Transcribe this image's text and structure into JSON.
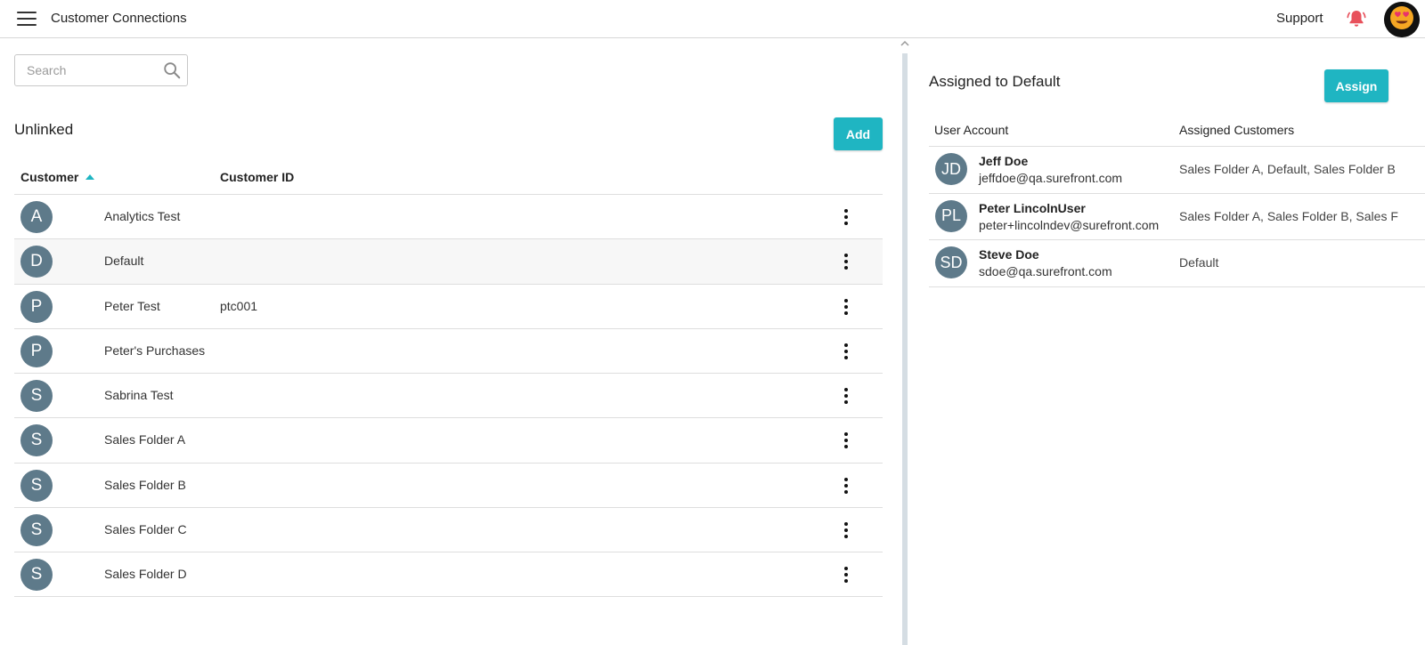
{
  "header": {
    "title": "Customer Connections",
    "support_label": "Support",
    "icons": {
      "menu": "hamburger-menu-icon",
      "bell": "bell-icon",
      "avatar": "emoji-heart-eyes-avatar"
    }
  },
  "search": {
    "placeholder": "Search",
    "value": ""
  },
  "unlinked": {
    "title": "Unlinked",
    "add_label": "Add",
    "columns": {
      "customer": "Customer",
      "customer_id": "Customer ID"
    },
    "sort": "ascending",
    "rows": [
      {
        "initial": "A",
        "name": "Analytics Test",
        "id": ""
      },
      {
        "initial": "D",
        "name": "Default",
        "id": ""
      },
      {
        "initial": "P",
        "name": "Peter Test",
        "id": "ptc001"
      },
      {
        "initial": "P",
        "name": "Peter's Purchases",
        "id": ""
      },
      {
        "initial": "S",
        "name": "Sabrina Test",
        "id": ""
      },
      {
        "initial": "S",
        "name": "Sales Folder A",
        "id": ""
      },
      {
        "initial": "S",
        "name": "Sales Folder B",
        "id": ""
      },
      {
        "initial": "S",
        "name": "Sales Folder C",
        "id": ""
      },
      {
        "initial": "S",
        "name": "Sales Folder D",
        "id": ""
      }
    ]
  },
  "assigned": {
    "title": "Assigned to Default",
    "assign_label": "Assign",
    "columns": {
      "user_account": "User Account",
      "assigned_customers": "Assigned Customers"
    },
    "rows": [
      {
        "initials": "JD",
        "name": "Jeff Doe",
        "email": "jeffdoe@qa.surefront.com",
        "customers": "Sales Folder A, Default, Sales Folder B"
      },
      {
        "initials": "PL",
        "name": "Peter LincolnUser",
        "email": "peter+lincolndev@surefront.com",
        "customers": "Sales Folder A, Sales Folder B, Sales F"
      },
      {
        "initials": "SD",
        "name": "Steve Doe",
        "email": "sdoe@qa.surefront.com",
        "customers": "Default"
      }
    ]
  },
  "colors": {
    "accent": "#1fb5c2",
    "avatar": "#5e7a8a",
    "bell": "#e8505b"
  }
}
